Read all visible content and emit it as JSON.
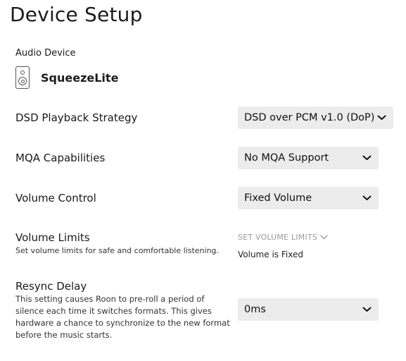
{
  "page": {
    "title": "Device Setup"
  },
  "audio_device": {
    "label": "Audio Device",
    "icon": "speaker-icon",
    "name": "SqueezeLite"
  },
  "settings": {
    "dsd": {
      "label": "DSD Playback Strategy",
      "value": "DSD over PCM v1.0 (DoP)"
    },
    "mqa": {
      "label": "MQA Capabilities",
      "value": "No MQA Support"
    },
    "volume_control": {
      "label": "Volume Control",
      "value": "Fixed Volume"
    },
    "volume_limits": {
      "label": "Volume Limits",
      "description": "Set volume limits for safe and comfortable listening.",
      "action": "SET VOLUME LIMITS",
      "status": "Volume is Fixed"
    },
    "resync": {
      "label": "Resync Delay",
      "description_lines": [
        "This setting causes Roon to pre-roll a period of",
        "silence each time it switches formats. This gives",
        "hardware a chance to synchronize to the new format",
        "before the music starts."
      ],
      "value": "0ms"
    }
  },
  "colors": {
    "select_bg": "#ececec",
    "muted_text": "#9a9a9a"
  }
}
